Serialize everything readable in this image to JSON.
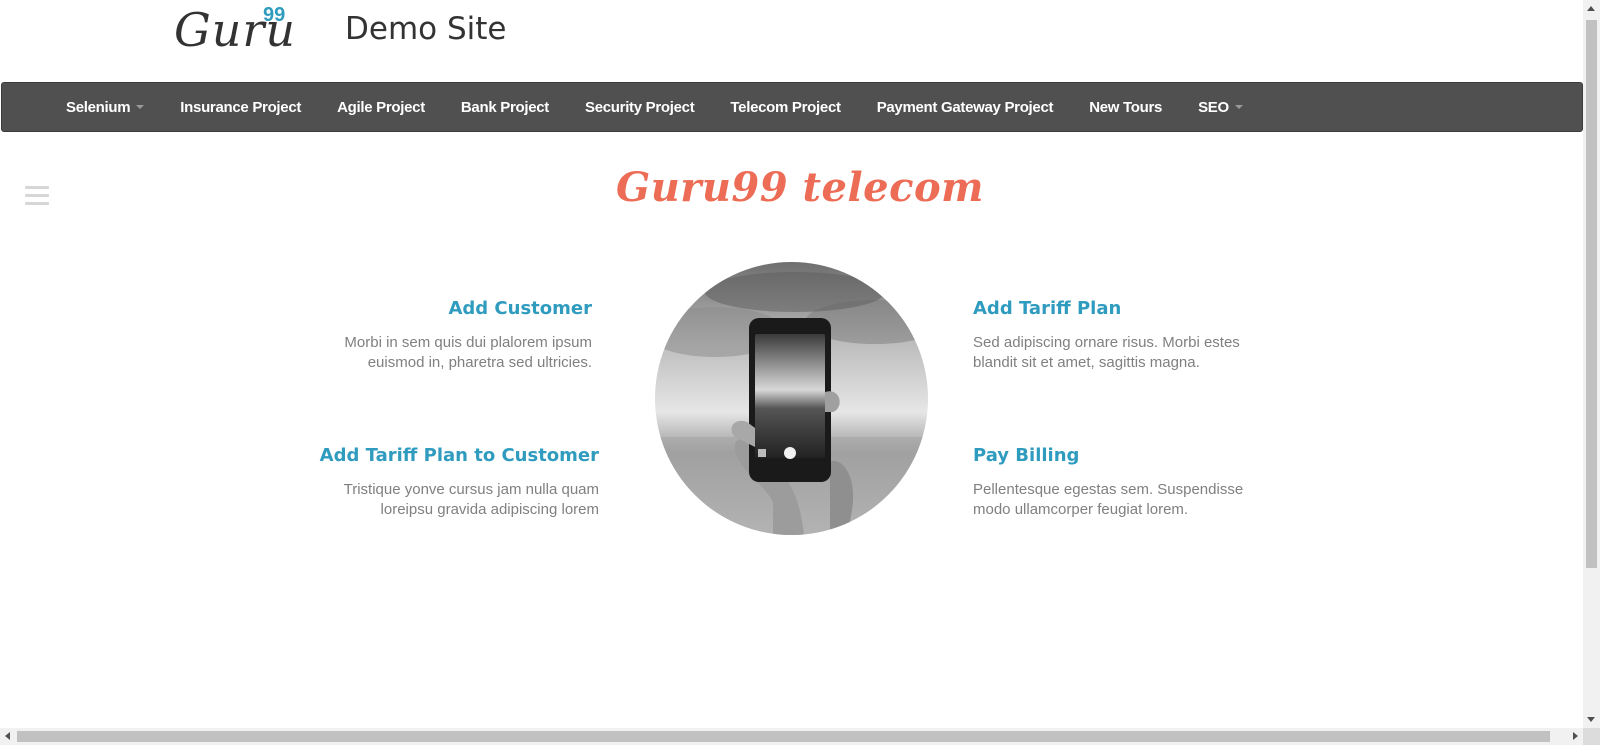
{
  "header": {
    "logo_text": "Guru",
    "logo_superscript": "99",
    "site_title": "Demo Site"
  },
  "nav": {
    "items": [
      {
        "label": "Selenium",
        "dropdown": true
      },
      {
        "label": "Insurance Project",
        "dropdown": false
      },
      {
        "label": "Agile Project",
        "dropdown": false
      },
      {
        "label": "Bank Project",
        "dropdown": false
      },
      {
        "label": "Security Project",
        "dropdown": false
      },
      {
        "label": "Telecom Project",
        "dropdown": false
      },
      {
        "label": "Payment Gateway Project",
        "dropdown": false
      },
      {
        "label": "New Tours",
        "dropdown": false
      },
      {
        "label": "SEO",
        "dropdown": true
      }
    ]
  },
  "main": {
    "title": "Guru99 telecom",
    "features": [
      {
        "title": "Add Customer",
        "line1": "Morbi in sem quis dui plalorem ipsum",
        "line2": "euismod in, pharetra sed ultricies."
      },
      {
        "title": "Add Tariff Plan to Customer",
        "line1": "Tristique yonve cursus jam nulla quam",
        "line2": "loreipsu gravida adipiscing lorem"
      },
      {
        "title": "Add Tariff Plan",
        "line1": "Sed adipiscing ornare risus. Morbi estes",
        "line2": "blandit sit et amet, sagittis magna."
      },
      {
        "title": "Pay Billing",
        "line1": "Pellentesque egestas sem. Suspendisse",
        "line2": "modo ullamcorper feugiat lorem."
      }
    ]
  },
  "colors": {
    "accent_blue": "#2f9cbf",
    "title_coral": "#ec6c56",
    "navbar_bg": "#505050"
  },
  "icons": {
    "menu": "hamburger-menu-icon",
    "hero": "phone-in-hand-photo"
  }
}
